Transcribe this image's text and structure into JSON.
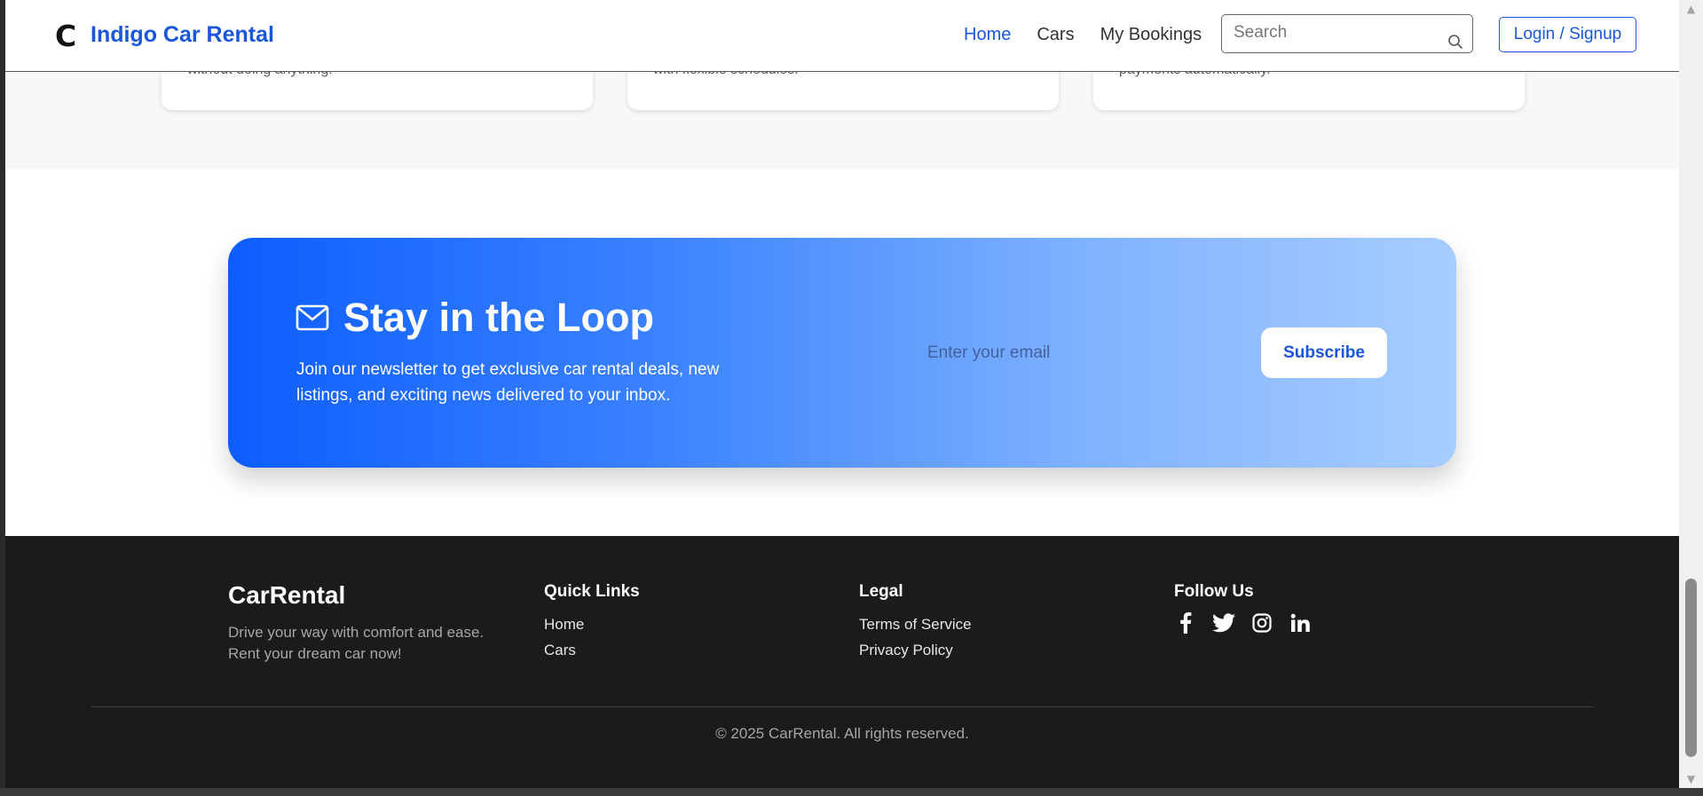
{
  "header": {
    "logo_mark": "C",
    "brand": "Indigo Car Rental",
    "nav": [
      {
        "label": "Home",
        "active": true
      },
      {
        "label": "Cars",
        "active": false
      },
      {
        "label": "My Bookings",
        "active": false
      }
    ],
    "search_placeholder": "Search",
    "login_label": "Login / Signup"
  },
  "features": {
    "cards": [
      {
        "text": "without doing anything!"
      },
      {
        "text": "with flexible schedules."
      },
      {
        "text": "payments automatically."
      }
    ]
  },
  "newsletter": {
    "title": "Stay in the Loop",
    "description": "Join our newsletter to get exclusive car rental deals, new listings, and exciting news delivered to your inbox.",
    "email_placeholder": "Enter your email",
    "subscribe_label": "Subscribe",
    "icon": "mail-icon"
  },
  "footer": {
    "brand": "CarRental",
    "tagline": "Drive your way with comfort and ease. Rent your dream car now!",
    "quick_links": {
      "heading": "Quick Links",
      "items": [
        "Home",
        "Cars"
      ]
    },
    "legal": {
      "heading": "Legal",
      "items": [
        "Terms of Service",
        "Privacy Policy"
      ]
    },
    "follow": {
      "heading": "Follow Us",
      "icons": [
        "facebook-icon",
        "twitter-icon",
        "instagram-icon",
        "linkedin-icon"
      ]
    },
    "copyright": "© 2025 CarRental. All rights reserved."
  },
  "colors": {
    "accent": "#1a56db",
    "footer_bg": "#1b1b1b",
    "newsletter_gradient_start": "#0d5dff",
    "newsletter_gradient_end": "#a8cdff"
  }
}
